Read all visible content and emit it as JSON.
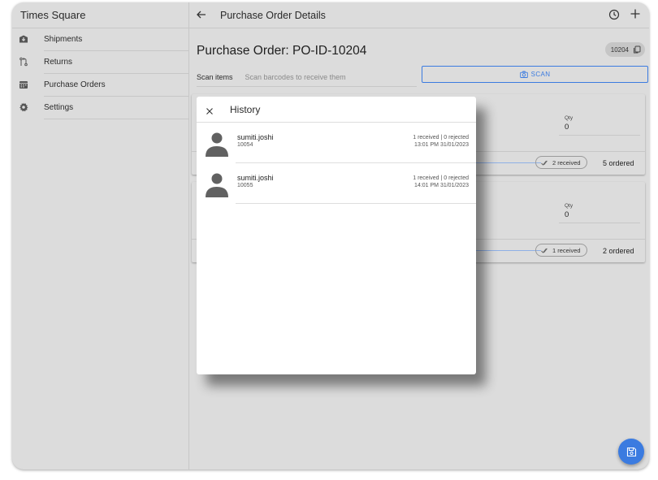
{
  "menu": {
    "title": "Times Square",
    "items": [
      {
        "label": "Shipments",
        "icon": "shipments-icon"
      },
      {
        "label": "Returns",
        "icon": "returns-icon"
      },
      {
        "label": "Purchase Orders",
        "icon": "calendar-icon"
      },
      {
        "label": "Settings",
        "icon": "gear-icon"
      }
    ]
  },
  "toolbar": {
    "title": "Purchase Order Details"
  },
  "page": {
    "po_title": "Purchase Order: PO-ID-10204",
    "po_badge": "10204",
    "scan_label": "Scan items",
    "scan_placeholder": "Scan barcodes to receive them",
    "scan_button": "SCAN"
  },
  "items": [
    {
      "qty_label": "Qty",
      "qty_value": "0",
      "received_chip": "2 received",
      "ordered": "5 ordered"
    },
    {
      "qty_label": "Qty",
      "qty_value": "0",
      "received_chip": "1 received",
      "ordered": "2 ordered"
    }
  ],
  "history": {
    "title": "History",
    "entries": [
      {
        "user": "sumiti.joshi",
        "id": "10054",
        "counts": "1 received | 0 rejected",
        "time": "13:01 PM 31/01/2023"
      },
      {
        "user": "sumiti.joshi",
        "id": "10055",
        "counts": "1 received | 0 rejected",
        "time": "14:01 PM 31/01/2023"
      }
    ]
  },
  "colors": {
    "accent": "#3b7be0",
    "background": "#dcdcdc",
    "modal": "#ffffff"
  }
}
